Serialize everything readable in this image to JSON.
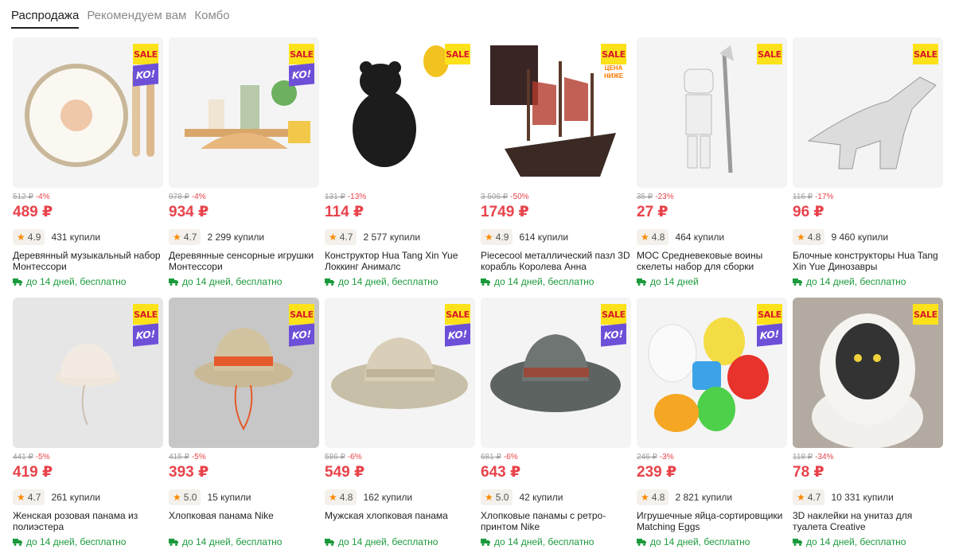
{
  "tabs": [
    "Распродажа",
    "Рекомендуем вам",
    "Комбо"
  ],
  "badges": {
    "sale": "SALE",
    "ko": "KO!",
    "low_price": "ЦЕНА НИЖЕ"
  },
  "colors": {
    "price": "#e8434b",
    "delivery": "#1b9a3b",
    "sale_bg": "#fde11a",
    "ko_bg": "#6e4fd8",
    "star": "#ff8a00"
  },
  "products": [
    {
      "old_price": "512 ₽",
      "discount": "-4%",
      "price": "489 ₽",
      "rating": "4.9",
      "bought": "431 купили",
      "title": "Деревянный музыкальный набор Монтессори",
      "delivery": "до 14 дней, бесплатно",
      "badges": [
        "sale",
        "ko"
      ],
      "image": "tambourine"
    },
    {
      "old_price": "978 ₽",
      "discount": "-4%",
      "price": "934 ₽",
      "rating": "4.7",
      "bought": "2 299 купили",
      "title": "Деревянные сенсорные игрушки Монтессори",
      "delivery": "до 14 дней, бесплатно",
      "badges": [
        "sale",
        "ko"
      ],
      "image": "wooden-toys"
    },
    {
      "old_price": "131 ₽",
      "discount": "-13%",
      "price": "114 ₽",
      "rating": "4.7",
      "bought": "2 577 купили",
      "title": "Конструктор Hua Tang Xin Yue Локкинг Анималс",
      "delivery": "до 14 дней, бесплатно",
      "badges": [
        "sale"
      ],
      "image": "bear"
    },
    {
      "old_price": "3 506 ₽",
      "discount": "-50%",
      "price": "1749 ₽",
      "rating": "4.9",
      "bought": "614 купили",
      "title": "Piececool металлический пазл 3D корабль Королева Анна",
      "delivery": "до 14 дней, бесплатно",
      "badges": [
        "sale",
        "low_price"
      ],
      "image": "ship"
    },
    {
      "old_price": "35 ₽",
      "discount": "-23%",
      "price": "27 ₽",
      "rating": "4.8",
      "bought": "464 купили",
      "title": "MOC Средневековые воины скелеты набор для сборки",
      "delivery": "до 14 дней",
      "badges": [
        "sale"
      ],
      "image": "skeleton"
    },
    {
      "old_price": "116 ₽",
      "discount": "-17%",
      "price": "96 ₽",
      "rating": "4.8",
      "bought": "9 460 купили",
      "title": "Блочные конструкторы Hua Tang Xin Yue Динозавры",
      "delivery": "до 14 дней, бесплатно",
      "badges": [
        "sale"
      ],
      "image": "dinosaur"
    },
    {
      "old_price": "441 ₽",
      "discount": "-5%",
      "price": "419 ₽",
      "rating": "4.7",
      "bought": "261 купили",
      "title": "Женская розовая панама из полиэстера",
      "delivery": "до 14 дней, бесплатно",
      "badges": [
        "sale",
        "ko"
      ],
      "image": "pink-hat"
    },
    {
      "old_price": "415 ₽",
      "discount": "-5%",
      "price": "393 ₽",
      "rating": "5.0",
      "bought": "15 купили",
      "title": "Хлопковая панама Nike",
      "delivery": "до 14 дней, бесплатно",
      "badges": [
        "sale",
        "ko"
      ],
      "image": "khaki-hat"
    },
    {
      "old_price": "586 ₽",
      "discount": "-6%",
      "price": "549 ₽",
      "rating": "4.8",
      "bought": "162 купили",
      "title": "Мужская хлопковая панама",
      "delivery": "до 14 дней, бесплатно",
      "badges": [
        "sale",
        "ko"
      ],
      "image": "bush-hat"
    },
    {
      "old_price": "681 ₽",
      "discount": "-6%",
      "price": "643 ₽",
      "rating": "5.0",
      "bought": "42 купили",
      "title": "Хлопковые панамы с ретро-принтом Nike",
      "delivery": "до 14 дней, бесплатно",
      "badges": [
        "sale",
        "ko"
      ],
      "image": "retro-hat"
    },
    {
      "old_price": "246 ₽",
      "discount": "-3%",
      "price": "239 ₽",
      "rating": "4.8",
      "bought": "2 821 купили",
      "title": "Игрушечные яйца-сортировщики Matching Eggs",
      "delivery": "до 14 дней, бесплатно",
      "badges": [
        "sale",
        "ko"
      ],
      "image": "eggs"
    },
    {
      "old_price": "118 ₽",
      "discount": "-34%",
      "price": "78 ₽",
      "rating": "4.7",
      "bought": "10 331 купили",
      "title": "3D наклейки на унитаз для туалета Creative",
      "delivery": "до 14 дней, бесплатно",
      "badges": [
        "sale"
      ],
      "image": "toilet-cat"
    }
  ]
}
